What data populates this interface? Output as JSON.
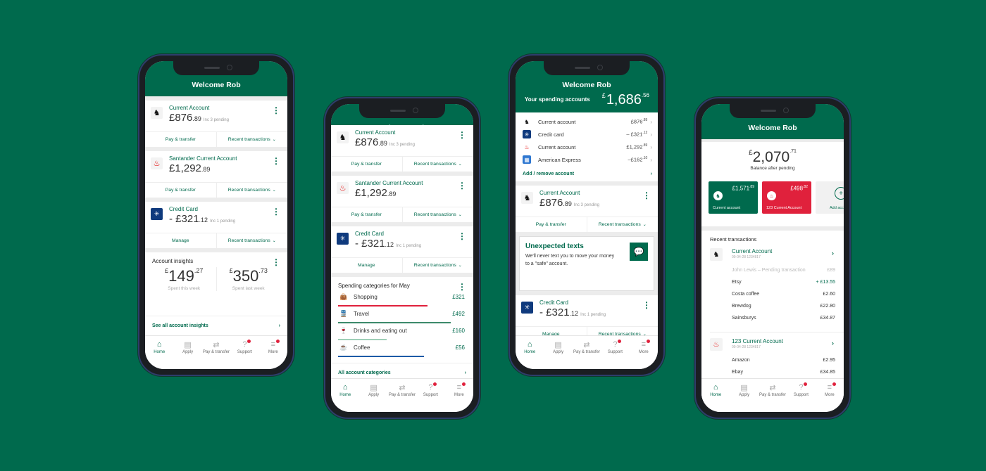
{
  "colors": {
    "brand_green": "#006a4d",
    "santander_red": "#e0213c",
    "mbna_blue": "#0f3a7d",
    "alert_dot": "#e0213c"
  },
  "header": {
    "title": "Welcome Rob"
  },
  "nav": [
    {
      "label": "Home",
      "icon": "home-icon",
      "glyph": "⌂",
      "active": true
    },
    {
      "label": "Apply",
      "icon": "apply-icon",
      "glyph": "▤"
    },
    {
      "label": "Pay & transfer",
      "icon": "pay-transfer-icon",
      "glyph": "⇄"
    },
    {
      "label": "Support",
      "icon": "support-icon",
      "glyph": "?",
      "badge": true
    },
    {
      "label": "More",
      "icon": "more-menu-icon",
      "glyph": "≡",
      "badge": true
    }
  ],
  "phone1": {
    "accounts": [
      {
        "name": "Current Account",
        "balance": "£876",
        "pence": ".89",
        "pending": "Inc 3 pending",
        "logo": "lloyds-horse-logo",
        "action1": "Pay & transfer",
        "action2": "Recent transactions"
      },
      {
        "name": "Santander Current Account",
        "balance": "£1,292",
        "pence": ".89",
        "pending": "",
        "logo": "santander-flame-logo",
        "action1": "Pay & transfer",
        "action2": "Recent transactions"
      },
      {
        "name": "Credit Card",
        "balance": "- £321",
        "pence": ".12",
        "pending": "Inc 1 pending",
        "logo": "mbna-card-logo",
        "action1": "Manage",
        "action2": "Recent transactions"
      }
    ],
    "insights": {
      "title": "Account insights",
      "this_week": {
        "currency": "£",
        "amount": "149",
        "pence": ".27",
        "caption": "Spent this week"
      },
      "last_week": {
        "currency": "£",
        "amount": "350",
        "pence": ".73",
        "caption": "Spent last week"
      },
      "link": "See all account insights"
    }
  },
  "phone2": {
    "accounts": [
      {
        "name": "Current Account",
        "balance": "£876",
        "pence": ".89",
        "pending": "Inc 3 pending",
        "action1": "Pay & transfer",
        "action2": "Recent transactions"
      },
      {
        "name": "Santander Current Account",
        "balance": "£1,292",
        "pence": ".89",
        "pending": "",
        "action1": "Pay & transfer",
        "action2": "Recent transactions"
      },
      {
        "name": "Credit Card",
        "balance": "- £321",
        "pence": ".12",
        "pending": "Inc 1 pending",
        "action1": "Manage",
        "action2": "Recent transactions"
      }
    ],
    "categories": {
      "title": "Spending categories for May",
      "items": [
        {
          "name": "Shopping",
          "amount": "£321",
          "icon": "shopping-bag-icon",
          "glyph": "👜",
          "color": "#e0213c",
          "fill": 0.7
        },
        {
          "name": "Travel",
          "amount": "£492",
          "icon": "train-icon",
          "glyph": "🚆",
          "color": "#3d8a6b",
          "fill": 0.88
        },
        {
          "name": "Drinks and eating out",
          "amount": "£160",
          "icon": "glass-icon",
          "glyph": "🍷",
          "color": "#9fcfb8",
          "fill": 0.38
        },
        {
          "name": "Coffee",
          "amount": "£56",
          "icon": "coffee-cup-icon",
          "glyph": "☕",
          "color": "#1d5aa6",
          "fill": 0.67
        }
      ],
      "link": "All account categories"
    }
  },
  "phone3": {
    "spending_label": "Your spending accounts",
    "total": {
      "currency": "£",
      "amount": "1,686",
      "pence": ".56"
    },
    "list": [
      {
        "name": "Current account",
        "value": "£876",
        "pence": ".89",
        "logo": "lloyds-horse-logo"
      },
      {
        "name": "Credit card",
        "value": "– £321",
        "pence": ".12",
        "logo": "mbna-card-logo"
      },
      {
        "name": "Current account",
        "value": "£1,292",
        "pence": ".89",
        "logo": "santander-flame-logo"
      },
      {
        "name": "American Express",
        "value": "–£162",
        "pence": ".10",
        "logo": "amex-logo"
      }
    ],
    "add_remove": "Add / remove account",
    "account": {
      "name": "Current Account",
      "balance": "£876",
      "pence": ".89",
      "pending": "Inc 3 pending",
      "action1": "Pay & transfer",
      "action2": "Recent transactions"
    },
    "alert": {
      "title": "Unexpected texts",
      "body": "We'll never text you to move your money to a \"safe\" account."
    },
    "credit": {
      "name": "Credit Card",
      "balance": "- £321",
      "pence": ".12",
      "pending": "Inc 1 pending",
      "action1": "Manage",
      "action2": "Recent transactions"
    }
  },
  "phone4": {
    "total": {
      "currency": "£",
      "amount": "2,070",
      "pence": ".71"
    },
    "total_caption": "Balance after pending",
    "tiles": [
      {
        "value": "£1,571",
        "pence": ".89",
        "name": "Current account",
        "color": "#006a4d"
      },
      {
        "value": "£498",
        "pence": ".82",
        "name": "123 Current Account",
        "color": "#e0213c"
      }
    ],
    "add_tile": "Add account",
    "recent_title": "Recent transactions",
    "groups": [
      {
        "name": "Current Account",
        "sort": "09-04-28   1234817",
        "tx": [
          {
            "desc": "John Lewis  – Pending transaction",
            "amount": "£89",
            "type": "pending"
          },
          {
            "desc": "Etsy",
            "amount": "+ £13.55",
            "type": "credit"
          },
          {
            "desc": "Costa coffee",
            "amount": "£2.60"
          },
          {
            "desc": "Brewdog",
            "amount": "£22.80"
          },
          {
            "desc": "Sainsburys",
            "amount": "£34.87"
          }
        ]
      },
      {
        "name": "123 Current Account",
        "sort": "09-04-28   1234817",
        "tx": [
          {
            "desc": "Amazon",
            "amount": "£2.95"
          },
          {
            "desc": "Ebay",
            "amount": "£34.85"
          }
        ]
      }
    ]
  }
}
